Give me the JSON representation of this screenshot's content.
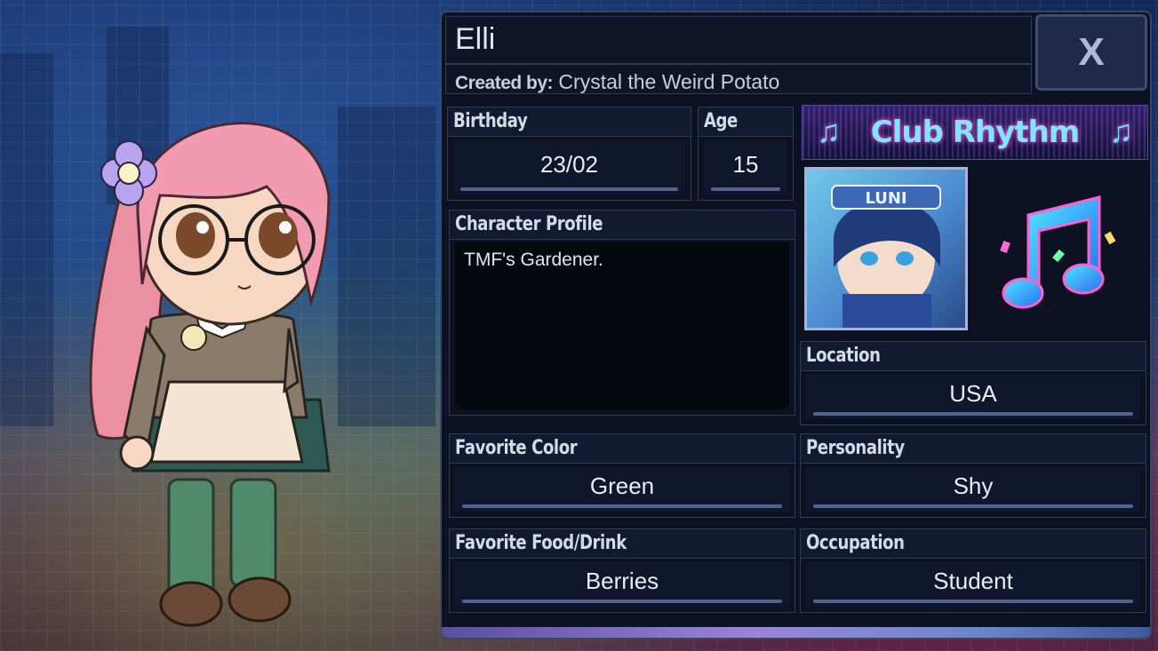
{
  "character": {
    "name": "Elli",
    "created_by_label": "Created by:",
    "creator": "Crystal the Weird Potato"
  },
  "close_button": {
    "label": "X"
  },
  "fields": {
    "birthday": {
      "label": "Birthday",
      "value": "23/02"
    },
    "age": {
      "label": "Age",
      "value": "15"
    },
    "profile": {
      "label": "Character Profile",
      "value": "TMF's Gardener."
    },
    "location": {
      "label": "Location",
      "value": "USA"
    },
    "favorite_color": {
      "label": "Favorite Color",
      "value": "Green"
    },
    "personality": {
      "label": "Personality",
      "value": "Shy"
    },
    "favorite_food": {
      "label": "Favorite Food/Drink",
      "value": "Berries"
    },
    "occupation": {
      "label": "Occupation",
      "value": "Student"
    }
  },
  "club": {
    "name": "Club Rhythm",
    "leader_badge_text": "LUNI",
    "icon": "music-note-icon"
  },
  "colors": {
    "panel_bg": "#0d1222",
    "accent_cyan": "#7fe6ff",
    "accent_pink": "#ff4fd8"
  }
}
